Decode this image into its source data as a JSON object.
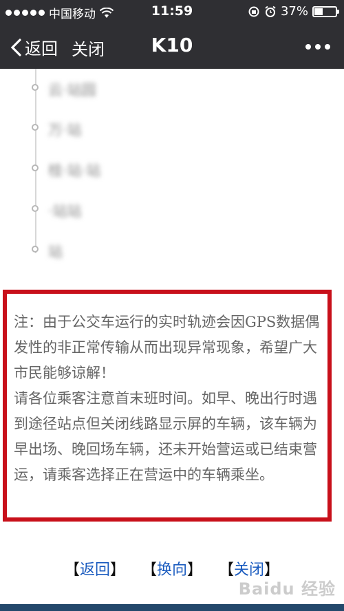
{
  "status_bar": {
    "carrier": "中国移动",
    "time": "11:59",
    "battery": "37%",
    "battery_level": 0.37
  },
  "nav": {
    "back_label": "返回",
    "close_label": "关闭",
    "title": "K10"
  },
  "stops": [
    {
      "name": "云·站园"
    },
    {
      "name": "万·站"
    },
    {
      "name": "桂·站·站"
    },
    {
      "name": "·站站"
    },
    {
      "name": "站"
    }
  ],
  "notice": {
    "paragraph_1": "注：由于公交车运行的实时轨迹会因GPS数据偶发性的非正常传输从而出现异常现象，希望广大市民能够谅解！",
    "paragraph_2": "请各位乘客注意首末班时间。如早、晚出行时遇到途径站点但关闭线路显示屏的车辆，该车辆为早出场、晚回场车辆，还未开始营运或已结束营运，请乘客选择正在营运中的车辆乘坐。"
  },
  "links": {
    "back": "返回",
    "switch": "换向",
    "close": "关闭",
    "open_bracket": "【",
    "close_bracket": "】"
  },
  "watermark": "Baidu 经验",
  "colors": {
    "header_bg": "#2f2f33",
    "notice_border": "#c8101a",
    "link": "#1a5bbf"
  }
}
